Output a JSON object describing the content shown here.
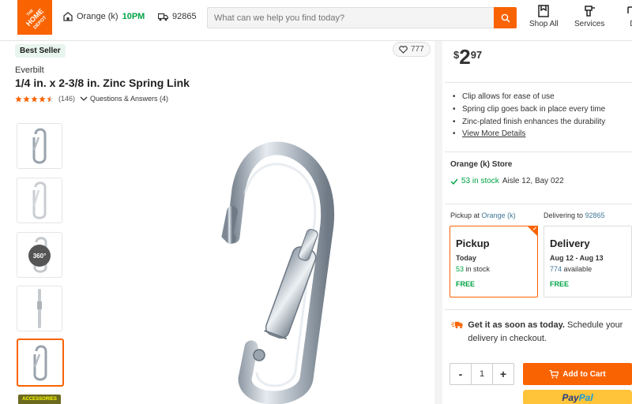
{
  "header": {
    "logo_text": "THE HOME DEPOT",
    "store_name": "Orange (k)",
    "store_hours": "10PM",
    "zip": "92865",
    "search_placeholder": "What can we help you find today?",
    "shop_all": "Shop All",
    "services": "Services",
    "cut_label": "D"
  },
  "product": {
    "badge": "Best Seller",
    "favorites": "777",
    "brand": "Everbilt",
    "title": "1/4 in. x 2-3/8 in. Zinc Spring Link",
    "rating": 4.5,
    "review_count": "(146)",
    "qa_label": "Questions & Answers (4)",
    "thumb_360_label": "360°",
    "accessories_label": "ACCESSORIES"
  },
  "price": {
    "currency": "$",
    "dollars": "2",
    "cents": "97"
  },
  "bullets": [
    "Clip allows for ease of use",
    "Spring clip goes back in place every time",
    "Zinc-plated finish enhances the durability"
  ],
  "view_more": "View More Details",
  "store_box": {
    "name": "Orange (k) Store",
    "stock": "53 in stock",
    "location": "Aisle 12, Bay 022"
  },
  "fulfillment": {
    "pickup_prefix": "Pickup at",
    "pickup_store": "Orange (k)",
    "delivering_prefix": "Delivering to",
    "delivering_zip": "92865",
    "pickup": {
      "title": "Pickup",
      "when": "Today",
      "avail_count": "53",
      "avail_text": "in stock",
      "price": "FREE"
    },
    "delivery": {
      "title": "Delivery",
      "when": "Aug 12 - Aug 13",
      "avail_count": "774",
      "avail_text": "available",
      "price": "FREE"
    }
  },
  "get_soon": {
    "bold": "Get it as soon as today.",
    "rest": " Schedule your delivery in checkout."
  },
  "cart": {
    "minus": "-",
    "quantity": "1",
    "plus": "+",
    "add_to_cart": "Add to Cart",
    "paypal_a": "Pay",
    "paypal_b": "Pal"
  },
  "colors": {
    "brand_orange": "#f96302",
    "stock_green": "#00a345",
    "link_blue": "#3e7697"
  }
}
